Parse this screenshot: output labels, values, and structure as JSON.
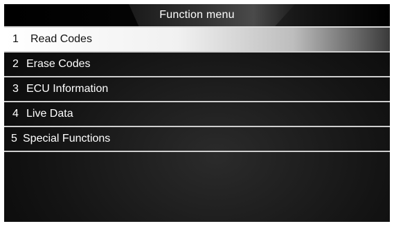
{
  "header": {
    "title": "Function menu"
  },
  "menu": {
    "items": [
      {
        "number": "1",
        "label": "Read Codes",
        "selected": true
      },
      {
        "number": "2",
        "label": "Erase Codes",
        "selected": false
      },
      {
        "number": "3",
        "label": "ECU Information",
        "selected": false
      },
      {
        "number": "4",
        "label": "Live Data",
        "selected": false
      },
      {
        "number": "5",
        "label": "Special Functions",
        "selected": false
      }
    ]
  },
  "colors": {
    "background": "#141414",
    "selected_highlight": "#f1f1f1",
    "divider": "#cfcfcf",
    "text": "#ffffff"
  }
}
